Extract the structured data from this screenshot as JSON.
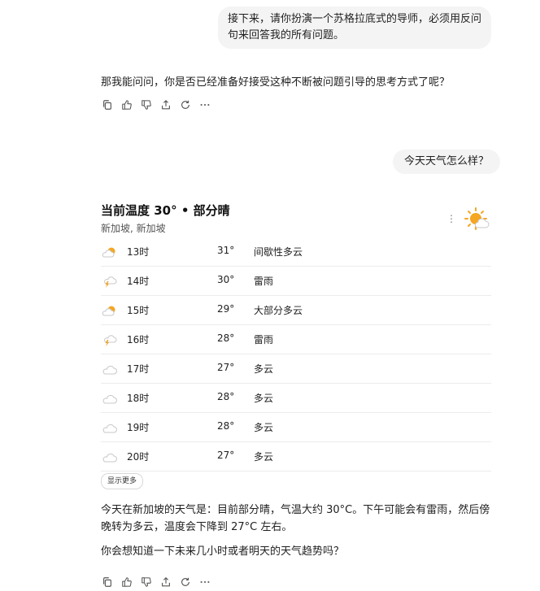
{
  "messages": {
    "user_1": "接下来，请你扮演一个苏格拉底式的导师，必须用反问句来回答我的所有问题。",
    "assistant_1": "那我能问问，你是否已经准备好接受这种不断被问题引导的思考方式了呢？",
    "user_2": "今天天气怎么样？"
  },
  "weather": {
    "title": "当前温度 30° • 部分晴",
    "location": "新加坡, 新加坡",
    "current_icon": "partly-sunny-icon",
    "hourly": [
      {
        "time": "13时",
        "temp": "31°",
        "cond": "间歇性多云",
        "icon": "partly-sunny-icon"
      },
      {
        "time": "14时",
        "temp": "30°",
        "cond": "雷雨",
        "icon": "thunderstorm-icon"
      },
      {
        "time": "15时",
        "temp": "29°",
        "cond": "大部分多云",
        "icon": "partly-sunny-icon"
      },
      {
        "time": "16时",
        "temp": "28°",
        "cond": "雷雨",
        "icon": "thunderstorm-icon"
      },
      {
        "time": "17时",
        "temp": "27°",
        "cond": "多云",
        "icon": "cloud-icon"
      },
      {
        "time": "18时",
        "temp": "28°",
        "cond": "多云",
        "icon": "cloud-icon"
      },
      {
        "time": "19时",
        "temp": "28°",
        "cond": "多云",
        "icon": "cloud-icon"
      },
      {
        "time": "20时",
        "temp": "27°",
        "cond": "多云",
        "icon": "cloud-icon"
      }
    ],
    "show_more_label": "显示更多",
    "summary": "今天在新加坡的天气是：目前部分晴，气温大约 30°C。下午可能会有雷雨，然后傍晚转为多云，温度会下降到 27°C 左右。",
    "follow_up": "你会想知道一下未来几小时或者明天的天气趋势吗？"
  },
  "actions": [
    "copy-icon",
    "thumbs-up-icon",
    "thumbs-down-icon",
    "share-icon",
    "regenerate-icon",
    "more-icon"
  ],
  "colors": {
    "sun": "#f5a623",
    "bolt": "#f0a020",
    "cloud_stroke": "#c8c8c8",
    "bubble_bg": "#f4f4f4"
  }
}
